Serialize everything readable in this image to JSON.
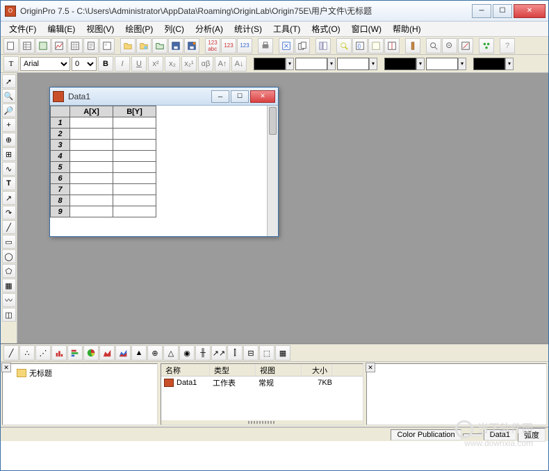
{
  "window": {
    "title": "OriginPro 7.5 - C:\\Users\\Administrator\\AppData\\Roaming\\OriginLab\\Origin75E\\用户文件\\无标题"
  },
  "menu": {
    "items": [
      "文件(F)",
      "编辑(E)",
      "视图(V)",
      "绘图(P)",
      "列(C)",
      "分析(A)",
      "统计(S)",
      "工具(T)",
      "格式(O)",
      "窗口(W)",
      "帮助(H)"
    ]
  },
  "format": {
    "font": "Arial",
    "size": "0"
  },
  "data_window": {
    "title": "Data1",
    "columns": [
      "A[X]",
      "B[Y]"
    ],
    "rows": [
      "1",
      "2",
      "3",
      "4",
      "5",
      "6",
      "7",
      "8",
      "9"
    ]
  },
  "project_tree": {
    "root": "无标题"
  },
  "list_panel": {
    "headers": {
      "name": "名称",
      "type": "类型",
      "view": "视图",
      "size": "大小"
    },
    "rows": [
      {
        "name": "Data1",
        "type": "工作表",
        "view": "常规",
        "size": "7KB"
      }
    ]
  },
  "status": {
    "color_pub": "Color Publication",
    "doc": "Data1",
    "mode": "弧度"
  },
  "watermark": {
    "brand": "当下软件园",
    "url": "www.downxia.com"
  },
  "colors": {
    "swatch": "#000000",
    "accent": "#3a6ea5"
  }
}
